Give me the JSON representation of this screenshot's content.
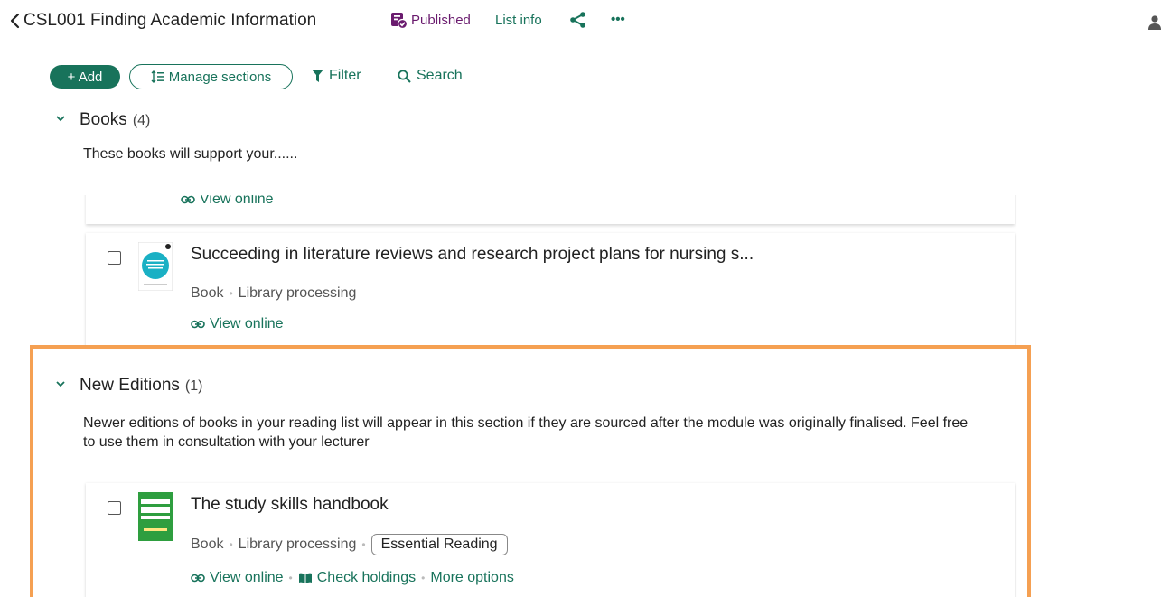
{
  "header": {
    "title": "CSL001 Finding Academic Information",
    "status": "Published",
    "list_info": "List info",
    "icons": [
      "chevron-left-icon",
      "published-icon",
      "share-icon",
      "more-icon",
      "user-icon"
    ]
  },
  "toolbar": {
    "add_label": "+ Add",
    "manage_label": "Manage sections",
    "filter_label": "Filter",
    "search_label": "Search"
  },
  "sections": [
    {
      "title": "Books",
      "count": "(4)",
      "description": "These books will support your......",
      "items": [
        {
          "title": "",
          "links": [
            "View online"
          ]
        },
        {
          "title": "Succeeding in literature reviews and research project plans for nursing s...",
          "type": "Book",
          "status": "Library processing",
          "links": [
            "View online"
          ]
        }
      ]
    },
    {
      "title": "New Editions",
      "count": "(1)",
      "description": "Newer editions of books in your reading list will appear in this section if they are sourced after the module was originally finalised. Feel free to use them in consultation with your lecturer",
      "items": [
        {
          "title": "The study skills handbook",
          "type": "Book",
          "status": "Library processing",
          "badge": "Essential Reading",
          "links": [
            "View online",
            "Check holdings",
            "More options"
          ]
        }
      ]
    }
  ],
  "colors": {
    "accent": "#18735b",
    "published": "#6a1b6e",
    "highlight": "#f5a052"
  }
}
